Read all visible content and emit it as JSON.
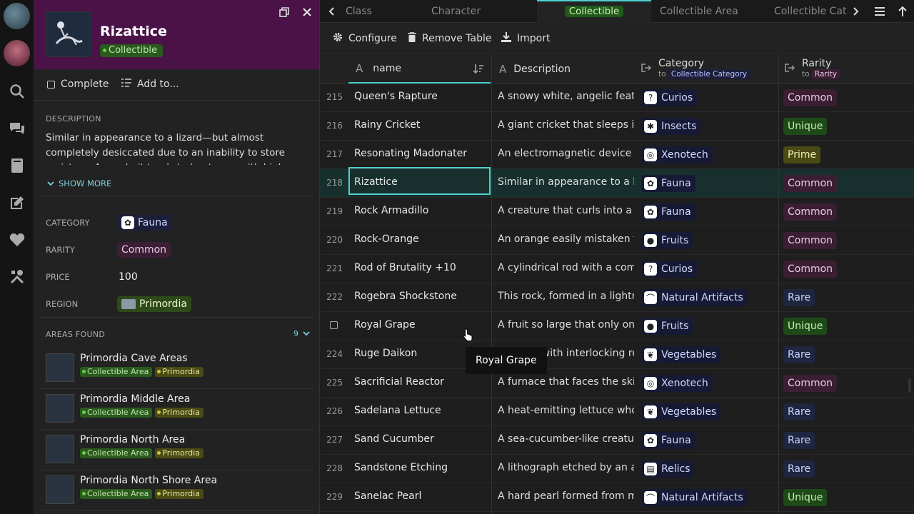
{
  "rail": {
    "icons": [
      "avatar-globe",
      "avatar-user",
      "search-icon",
      "chat-icon",
      "book-icon",
      "edit-icon",
      "heart-icon",
      "tools-icon"
    ]
  },
  "detail": {
    "title": "Rizattice",
    "type_tag": "Collectible",
    "complete_label": "Complete",
    "add_to_label": "Add to...",
    "description_label": "DESCRIPTION",
    "description_text": "Similar in appearance to a lizard—but almost completely desiccated due to an inability to store moisture. As such, it tends to hunt prey with high water content.",
    "show_more": "SHOW MORE",
    "props": {
      "category_label": "CATEGORY",
      "category_value": "Fauna",
      "rarity_label": "RARITY",
      "rarity_value": "Common",
      "price_label": "PRICE",
      "price_value": "100",
      "region_label": "REGION",
      "region_value": "Primordia"
    },
    "areas_label": "AREAS FOUND",
    "areas_count": "9",
    "areas": [
      {
        "name": "Primordia Cave Areas",
        "tag1": "Collectible Area",
        "tag2": "Primordia"
      },
      {
        "name": "Primordia Middle Area",
        "tag1": "Collectible Area",
        "tag2": "Primordia"
      },
      {
        "name": "Primordia North Area",
        "tag1": "Collectible Area",
        "tag2": "Primordia"
      },
      {
        "name": "Primordia North Shore Area",
        "tag1": "Collectible Area",
        "tag2": "Primordia"
      }
    ]
  },
  "tabs": {
    "items": [
      "Class",
      "Character",
      "Collectible",
      "Collectible Area",
      "Collectible Cate"
    ]
  },
  "toolbar": {
    "configure": "Configure",
    "remove_table": "Remove Table",
    "import": "Import"
  },
  "columns": {
    "name": "name",
    "description": "Description",
    "category": "Category",
    "category_to": "to",
    "category_link": "Collectible Category",
    "rarity": "Rarity",
    "rarity_to": "to",
    "rarity_link": "Rarity"
  },
  "rows": [
    {
      "num": "215",
      "name": "Queen's Rapture",
      "desc": "A snowy white, angelic feather",
      "cat": "Curios",
      "cat_icon": "?",
      "rarity": "Common"
    },
    {
      "num": "216",
      "name": "Rainy Cricket",
      "desc": "A giant cricket that sleeps in the",
      "cat": "Insects",
      "cat_icon": "✱",
      "rarity": "Unique"
    },
    {
      "num": "217",
      "name": "Resonating Madonater",
      "desc": "An electromagnetic device used",
      "cat": "Xenotech",
      "cat_icon": "◎",
      "rarity": "Prime"
    },
    {
      "num": "218",
      "name": "Rizattice",
      "desc": "Similar in appearance to a lizard",
      "cat": "Fauna",
      "cat_icon": "✿",
      "rarity": "Common"
    },
    {
      "num": "219",
      "name": "Rock Armadillo",
      "desc": "A creature that curls into a ball",
      "cat": "Fauna",
      "cat_icon": "✿",
      "rarity": "Common"
    },
    {
      "num": "220",
      "name": "Rock-Orange",
      "desc": "An orange easily mistaken for a",
      "cat": "Fruits",
      "cat_icon": "●",
      "rarity": "Common"
    },
    {
      "num": "221",
      "name": "Rod of Brutality +10",
      "desc": "A cylindrical rod with a complex",
      "cat": "Curios",
      "cat_icon": "?",
      "rarity": "Common"
    },
    {
      "num": "222",
      "name": "Rogebra Shockstone",
      "desc": "This rock, formed in a lightning",
      "cat": "Natural Artifacts",
      "cat_icon": "⌒",
      "rarity": "Rare"
    },
    {
      "num": "",
      "name": "Royal Grape",
      "desc": "A fruit so large that only one gr",
      "cat": "Fruits",
      "cat_icon": "●",
      "rarity": "Unique"
    },
    {
      "num": "224",
      "name": "Ruge Daikon",
      "desc": "A radish with interlocking roots",
      "cat": "Vegetables",
      "cat_icon": "❦",
      "rarity": "Rare"
    },
    {
      "num": "225",
      "name": "Sacrificial Reactor",
      "desc": "A furnace that faces the skies in",
      "cat": "Xenotech",
      "cat_icon": "◎",
      "rarity": "Common"
    },
    {
      "num": "226",
      "name": "Sadelana Lettuce",
      "desc": "A heat-emitting lettuce whose t",
      "cat": "Vegetables",
      "cat_icon": "❦",
      "rarity": "Rare"
    },
    {
      "num": "227",
      "name": "Sand Cucumber",
      "desc": "A sea-cucumber-like creature th",
      "cat": "Fauna",
      "cat_icon": "✿",
      "rarity": "Rare"
    },
    {
      "num": "228",
      "name": "Sandstone Etching",
      "desc": "A lithograph etched by an ancie",
      "cat": "Relics",
      "cat_icon": "▤",
      "rarity": "Rare"
    },
    {
      "num": "229",
      "name": "Sanelac Pearl",
      "desc": "A hard pearl formed from mine",
      "cat": "Natural Artifacts",
      "cat_icon": "⌒",
      "rarity": "Unique"
    }
  ],
  "tooltip": "Royal Grape",
  "colors": {
    "header_bg": "#4a1247",
    "accent": "#4fd0d0",
    "selected_row": "#17302d"
  }
}
